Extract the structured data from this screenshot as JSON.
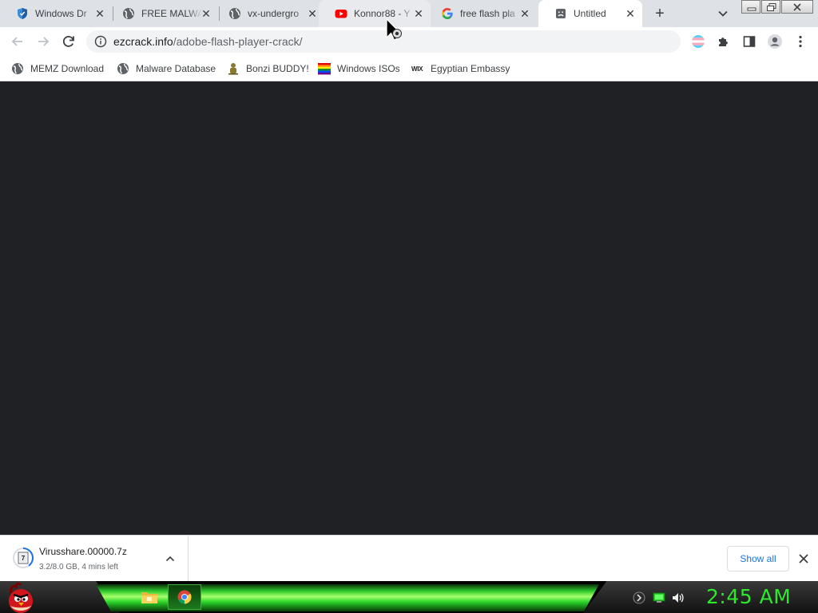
{
  "browser": {
    "tabs": [
      {
        "title": "Windows Dr",
        "favicon": "shield-icon",
        "active": false
      },
      {
        "title": "FREE MALWA",
        "favicon": "globe-icon",
        "active": false
      },
      {
        "title": "vx-undergro",
        "favicon": "globe-icon",
        "active": false
      },
      {
        "title": "Konnor88 - Y",
        "favicon": "youtube-icon",
        "active": false
      },
      {
        "title": "free flash pla",
        "favicon": "google-icon",
        "active": false
      },
      {
        "title": "Untitled",
        "favicon": "sad-page-icon",
        "active": true
      }
    ],
    "new_tab_symbol": "+",
    "close_symbol": "✕",
    "omnibox": {
      "host": "ezcrack.info",
      "path": "/adobe-flash-player-crack/"
    },
    "bookmarks": [
      {
        "label": "MEMZ Download",
        "icon": "globe-icon"
      },
      {
        "label": "Malware Database",
        "icon": "globe-icon"
      },
      {
        "label": "Bonzi BUDDY!",
        "icon": "bonzi-icon"
      },
      {
        "label": "Windows ISOs",
        "icon": "rainbow-flag-icon"
      },
      {
        "label": "Egyptian Embassy",
        "icon": "wix-icon"
      }
    ],
    "wix_text": "WIX",
    "content_background": "#202124"
  },
  "download_shelf": {
    "file_name": "Virusshare.00000.7z",
    "status": "3.2/8.0 GB, 4 mins left",
    "progress_fraction": 0.4,
    "show_all_label": "Show all"
  },
  "taskbar": {
    "clock": "2:45 AM",
    "clock_color": "#2ee82e",
    "accent_green": "#2cc92c",
    "pinned": [
      "file-explorer-icon",
      "chrome-icon"
    ],
    "tray": [
      "sim-card-icon",
      "network-icon",
      "volume-icon"
    ]
  },
  "colors": {
    "tabstrip": "#dee1e6",
    "toolbar": "#ffffff",
    "link_blue": "#1a73e8"
  }
}
